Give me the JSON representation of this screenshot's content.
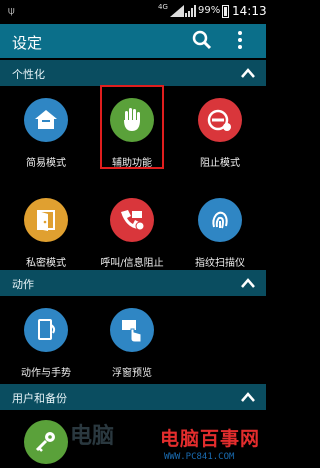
{
  "status_bar": {
    "usb_icon": "usb-icon",
    "network": "4G",
    "battery_percent": "99%",
    "time": "14:13"
  },
  "action_bar": {
    "title": "设定",
    "search_icon": "search-icon",
    "more_icon": "more-vert-icon"
  },
  "sections": [
    {
      "title": "个性化",
      "items": [
        {
          "label": "简易模式",
          "icon": "easy-mode-icon",
          "color": "#2f86c4"
        },
        {
          "label": "辅助功能",
          "icon": "hand-icon",
          "color": "#5aa13a"
        },
        {
          "label": "阻止模式",
          "icon": "block-mode-icon",
          "color": "#d9363b"
        },
        {
          "label": "私密模式",
          "icon": "private-mode-icon",
          "color": "#e0a030"
        },
        {
          "label": "呼叫/信息阻止",
          "icon": "call-block-icon",
          "color": "#d9363b"
        },
        {
          "label": "指纹扫描仪",
          "icon": "fingerprint-icon",
          "color": "#2f86c4"
        }
      ]
    },
    {
      "title": "动作",
      "items": [
        {
          "label": "动作与手势",
          "icon": "motion-icon",
          "color": "#2f86c4"
        },
        {
          "label": "浮窗预览",
          "icon": "air-view-icon",
          "color": "#2f86c4"
        }
      ]
    },
    {
      "title": "用户和备份",
      "items": [
        {
          "label": "",
          "icon": "key-icon",
          "color": "#5aa13a"
        }
      ]
    }
  ],
  "watermark": {
    "text": "电脑百事网",
    "url": "WWW.PC841.COM"
  }
}
